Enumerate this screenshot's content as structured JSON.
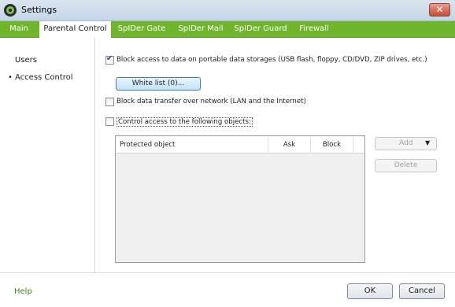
{
  "window": {
    "title": "Settings",
    "close_glyph": "✕"
  },
  "tabs": [
    {
      "label": "Main"
    },
    {
      "label": "Parental Control",
      "active": true
    },
    {
      "label": "SpIDer Gate"
    },
    {
      "label": "SpIDer Mail"
    },
    {
      "label": "SpIDer Guard"
    },
    {
      "label": "Firewall"
    }
  ],
  "sidebar": {
    "items": [
      {
        "label": "Users"
      },
      {
        "label": "Access Control",
        "selected": true,
        "bullet": "•"
      }
    ]
  },
  "options": {
    "block_portable": {
      "label": "Block access to data on portable data storages (USB flash, floppy, CD/DVD, ZIP drives, etc.)",
      "checked": true
    },
    "whitelist_button": "White list (0)...",
    "block_network": {
      "label": "Block data transfer over network (LAN and the Internet)",
      "checked": false
    },
    "control_access": {
      "label": "Control access to the following objects:",
      "checked": false
    }
  },
  "table": {
    "columns": [
      "Protected object",
      "Ask",
      "Block"
    ],
    "rows": []
  },
  "side_buttons": {
    "add": "Add",
    "add_arrow": "▼",
    "delete": "Delete"
  },
  "footer": {
    "help": "Help",
    "ok": "OK",
    "cancel": "Cancel"
  },
  "colors": {
    "accent_green": "#6fb62c",
    "help_green": "#3a8a14"
  }
}
